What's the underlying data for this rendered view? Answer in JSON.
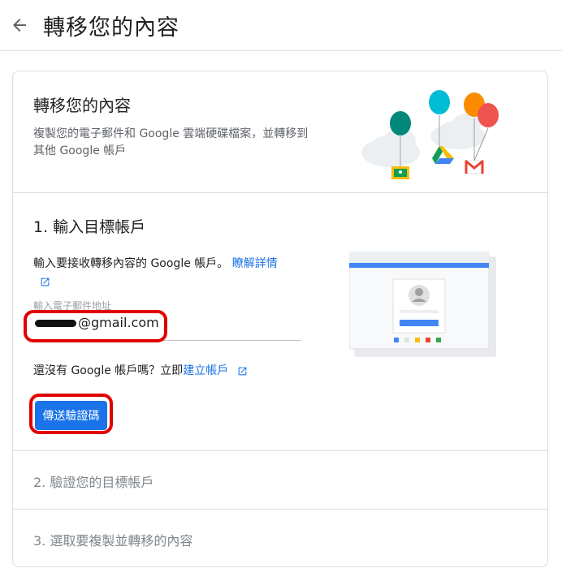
{
  "header": {
    "title": "轉移您的內容"
  },
  "intro": {
    "title": "轉移您的內容",
    "description": "複製您的電子郵件和 Google 雲端硬碟檔案，並轉移到其他 Google 帳戶"
  },
  "step1": {
    "title": "1. 輸入目標帳戶",
    "description": "輸入要接收轉移內容的 Google 帳戶。",
    "learn_more": "瞭解詳情",
    "email_label": "輸入電子郵件地址",
    "email_value": "@gmail.com",
    "no_account_text": "還沒有 Google 帳戶嗎？立即",
    "create_account_link": "建立帳戶",
    "send_button": "傳送驗證碼"
  },
  "step2": {
    "title": "2. 驗證您的目標帳戶"
  },
  "step3": {
    "title": "3. 選取要複製並轉移的內容"
  },
  "colors": {
    "accent": "#1a73e8",
    "highlight": "#e00000",
    "divider": "#dadce0"
  },
  "icons": [
    "back-arrow-icon",
    "open-in-new-icon",
    "google-classroom-icon",
    "google-drive-icon",
    "gmail-icon",
    "avatar-icon"
  ]
}
